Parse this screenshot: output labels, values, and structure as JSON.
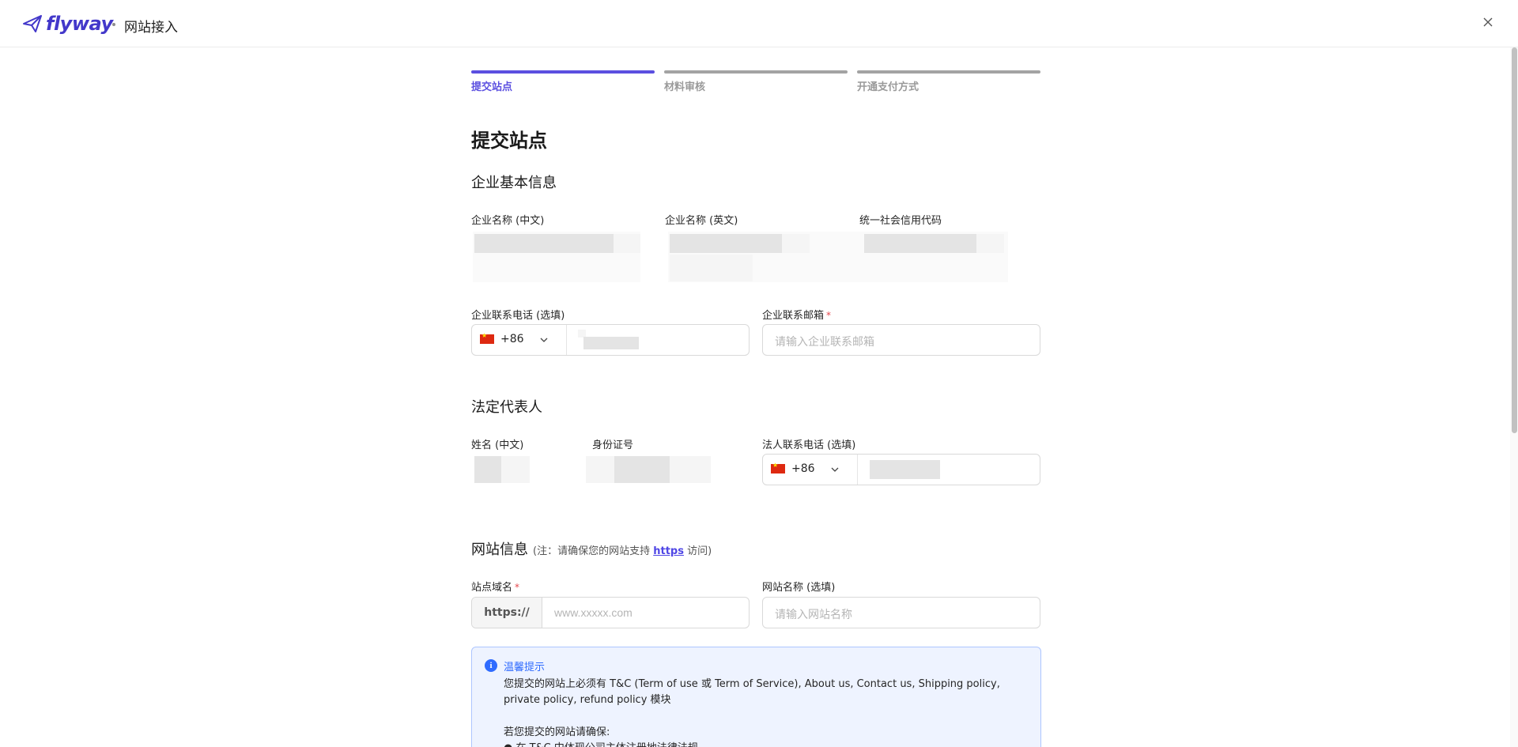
{
  "header": {
    "brand": "flyway",
    "page_title": "网站接入"
  },
  "steps": [
    {
      "label": "提交站点",
      "active": true
    },
    {
      "label": "材料审核",
      "active": false
    },
    {
      "label": "开通支付方式",
      "active": false
    }
  ],
  "form": {
    "title": "提交站点",
    "company_section": {
      "heading": "企业基本信息",
      "name_cn_label": "企业名称 (中文)",
      "name_en_label": "企业名称 (英文)",
      "credit_code_label": "统一社会信用代码",
      "phone_label": "企业联系电话 (选填)",
      "phone_country_code": "+86",
      "email_label": "企业联系邮箱",
      "email_required_mark": "*",
      "email_placeholder": "请输入企业联系邮箱"
    },
    "legal_section": {
      "heading": "法定代表人",
      "name_label": "姓名 (中文)",
      "id_label": "身份证号",
      "phone_label": "法人联系电话 (选填)",
      "phone_country_code": "+86"
    },
    "website_section": {
      "heading": "网站信息",
      "note_prefix": "(注：请确保您的网站支持",
      "note_link": "https",
      "note_suffix": "访问)",
      "domain_label": "站点域名",
      "domain_required_mark": "*",
      "domain_prefix": "https://",
      "domain_placeholder": "www.xxxxx.com",
      "site_name_label": "网站名称 (选填)",
      "site_name_placeholder": "请输入网站名称"
    },
    "tip": {
      "icon": "info-icon",
      "title": "温馨提示",
      "text": "您提交的网站上必须有 T&C (Term of use 或 Term of Service), About us, Contact us, Shipping policy, private policy, refund policy 模块",
      "text2": "若您提交的网站请确保:",
      "bullet": "● 在 T&C 中体现公司主体注册地法律法规"
    }
  },
  "colors": {
    "accent": "#5b4fe0",
    "link": "#4f46e5",
    "required": "#e5484d",
    "tip_bg": "#eef3ff",
    "tip_border": "#adc6ff"
  }
}
